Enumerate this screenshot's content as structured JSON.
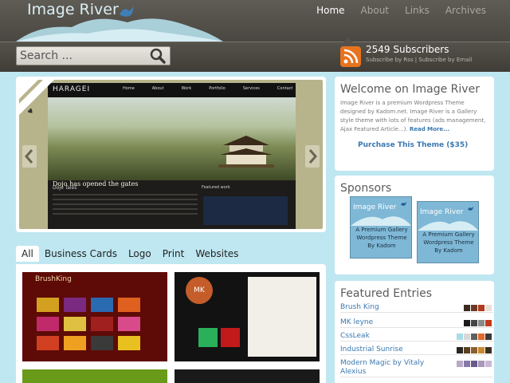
{
  "header": {
    "logo": "Image River",
    "nav": [
      "Home",
      "About",
      "Links",
      "Archives"
    ],
    "active_nav": 0
  },
  "search": {
    "placeholder": "Search ..."
  },
  "subscribe": {
    "count": "2549 Subscribers",
    "links": "Subscribe by Rss | Subscribe by Email"
  },
  "featured": {
    "ribbon": "Featured",
    "shot": {
      "logo": "HARAGEI",
      "nav": [
        "Home",
        "About",
        "Work",
        "Portfolio",
        "Services",
        "Contact"
      ],
      "caption": "Dojo has opened the gates",
      "left_heading": "Dojo Tales",
      "right_heading": "Featured work"
    }
  },
  "tabs": [
    "All",
    "Business Cards",
    "Logo",
    "Print",
    "Websites"
  ],
  "gallery": {
    "item1_logo": "BrushKing",
    "item2_badge": "MK"
  },
  "welcome": {
    "title": "Welcome on Image River",
    "text": "Image River is a premium Wordpress Theme designed by Kadom.net. Image River is a Gallery style theme with lots of features (ads management, Ajax Featured Article...).",
    "more": "Read More...",
    "purchase": "Purchase This Theme ($35)"
  },
  "sponsors": {
    "title": "Sponsors",
    "ad_title": "Image River",
    "ad_sub": "A Premium Gallery Wordpress Theme By Kadom"
  },
  "featured_entries": {
    "title": "Featured Entries",
    "items": [
      {
        "name": "Brush King",
        "colors": [
          "#3a2a20",
          "#6a3a26",
          "#b23a1e",
          "#e8e0d8"
        ]
      },
      {
        "name": "MK leyne",
        "colors": [
          "#1a1a1a",
          "#454545",
          "#8a8a8a",
          "#c23a1a"
        ]
      },
      {
        "name": "CssLeak",
        "colors": [
          "#a8dce8",
          "#d8d8d8",
          "#5e5e5e",
          "#e26a2a",
          "#3a3a3a"
        ]
      },
      {
        "name": "Industrial Sunrise",
        "colors": [
          "#2a2520",
          "#5a4020",
          "#8a6030",
          "#c88a30",
          "#3a3020"
        ]
      },
      {
        "name": "Modern Magic by Vitaly Alexius",
        "colors": [
          "#b8a8c8",
          "#8878a8",
          "#6a5a8a",
          "#a898b8",
          "#c8b8d8"
        ]
      }
    ]
  }
}
